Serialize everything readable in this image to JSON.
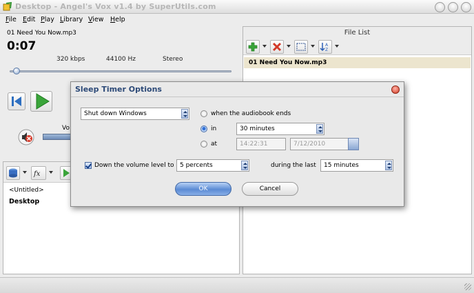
{
  "window": {
    "title": "Desktop - Angel's Vox v1.4 by SuperUtils.com"
  },
  "menu": [
    {
      "label": "File",
      "key": "F"
    },
    {
      "label": "Edit",
      "key": "E"
    },
    {
      "label": "Play",
      "key": "P"
    },
    {
      "label": "Library",
      "key": "L"
    },
    {
      "label": "View",
      "key": "V"
    },
    {
      "label": "Help",
      "key": "H"
    }
  ],
  "player": {
    "track_name": "01 Need You Now.mp3",
    "elapsed": "0:07",
    "bitrate": "320 kbps",
    "sample_rate": "44100 Hz",
    "channels": "Stereo",
    "seek_fraction": 0.02,
    "volume_label_partial": "Vo"
  },
  "library": {
    "items": [
      "<Untitled>",
      "Desktop"
    ]
  },
  "file_list": {
    "header": "File List",
    "rows": [
      "01 Need You Now.mp3"
    ]
  },
  "dialog": {
    "title": "Sleep Timer Options",
    "action": "Shut down Windows",
    "option_end": "when the audiobook ends",
    "option_in": "in",
    "in_value": "30 minutes",
    "option_at": "at",
    "at_time": "14:22:31",
    "at_date": "7/12/2010",
    "down_volume_label": "Down the volume level to",
    "volume_level": "5 percents",
    "during_label": "during the last",
    "during_value": "15 minutes",
    "ok": "OK",
    "cancel": "Cancel"
  },
  "colors": {
    "play_green": "#3aa53a",
    "accent_blue": "#2f6fd6",
    "selected_row": "#ece5ce",
    "dialog_title": "#2d4a78"
  }
}
